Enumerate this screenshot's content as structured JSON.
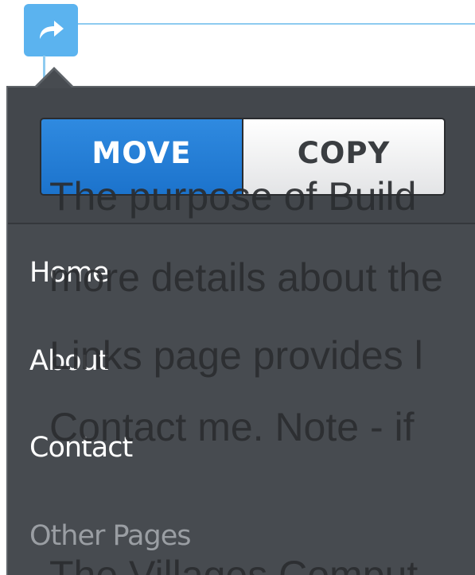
{
  "toggle": {
    "move_label": "MOVE",
    "copy_label": "COPY",
    "selected": "MOVE"
  },
  "menu": {
    "items": [
      {
        "label": "Home"
      },
      {
        "label": "About"
      },
      {
        "label": "Contact"
      }
    ],
    "section_label": "Other Pages"
  },
  "background_page": {
    "lines": [
      "The purpose of Build",
      "more details about the",
      "Links page provides l",
      "Contact me. Note - if",
      "The Villages Comput"
    ]
  },
  "colors": {
    "accent": "#1c73cc",
    "handle": "#5bb3ef",
    "panel": "#474b50"
  },
  "icons": {
    "handle_icon": "arrow-redo-icon"
  }
}
